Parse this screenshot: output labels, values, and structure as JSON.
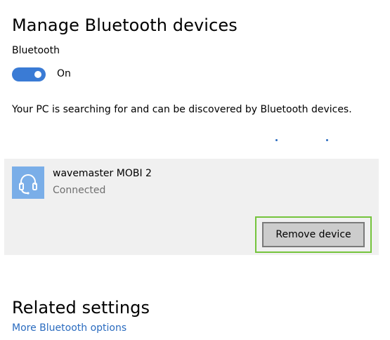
{
  "page": {
    "title": "Manage Bluetooth devices"
  },
  "bluetooth": {
    "label": "Bluetooth",
    "toggle_state": "On",
    "enabled": true,
    "status_text": "Your PC is searching for and can be discovered by Bluetooth devices."
  },
  "devices": [
    {
      "name": "wavemaster MOBI 2",
      "status": "Connected",
      "icon": "headset-icon",
      "action_label": "Remove device"
    }
  ],
  "related": {
    "title": "Related settings",
    "link_label": "More Bluetooth options"
  },
  "colors": {
    "accent": "#3a7bd5",
    "link": "#2a6bbf",
    "device_icon_bg": "#7aaee8",
    "panel_bg": "#f0f0f0",
    "highlight": "#75c43c"
  }
}
